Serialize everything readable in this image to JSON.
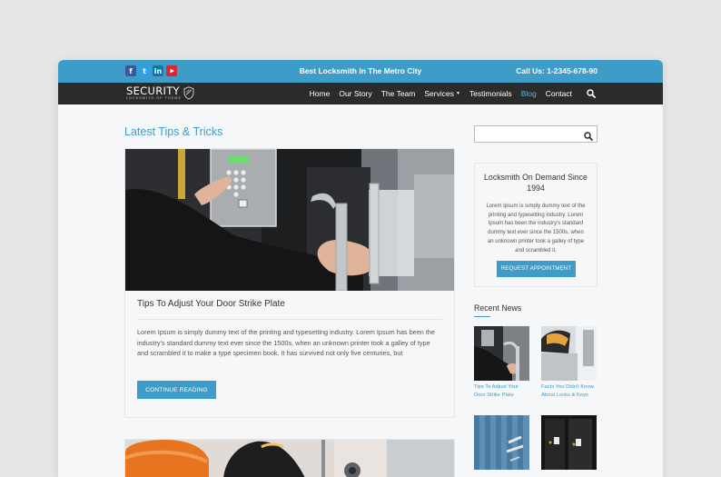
{
  "topbar": {
    "social": [
      "f",
      "t",
      "in",
      "yt"
    ],
    "tagline": "Best Locksmith In The Metro City",
    "phone": "Call Us: 1-2345-678-90"
  },
  "brand": {
    "name": "SECURITY",
    "sub": "LOCKSMITH OF THEME"
  },
  "nav": {
    "items": [
      {
        "label": "Home"
      },
      {
        "label": "Our Story"
      },
      {
        "label": "The Team"
      },
      {
        "label": "Services"
      },
      {
        "label": "Testimonials"
      },
      {
        "label": "Blog"
      },
      {
        "label": "Contact"
      }
    ]
  },
  "main": {
    "heading": "Latest Tips & Tricks",
    "post": {
      "title": "Tips To Adjust Your Door Strike Plate",
      "excerpt": "Lorem Ipsum is simply dummy text of the printing and typesetting industry. Lorem Ipsum has been the industry's standard dummy text ever since the 1500s, when an unknown printer took a galley of type and scrambled it to make a type specimen book. It has survived not only five centuries, but",
      "button": "CONTINUE READING"
    }
  },
  "sidebar": {
    "search_placeholder": "",
    "widget": {
      "title": "Locksmith On Demand Since 1994",
      "text": "Lorem Ipsum is simply dummy text of the printing and typesetting industry. Lorem Ipsum has been the industry's standard dummy text ever since the 1500s, when an unknown printer took a galley of type and scrambled it.",
      "button": "REQUEST APPOINTMENT"
    },
    "recent": {
      "title": "Recent News",
      "items": [
        {
          "caption": "Tips To Adjust Your Door Strike Plate"
        },
        {
          "caption": "Facts You Didn't Know About Locks & Keys"
        }
      ]
    }
  },
  "colors": {
    "accent": "#3d9dc8",
    "nav_bg": "#2b2b2b"
  }
}
